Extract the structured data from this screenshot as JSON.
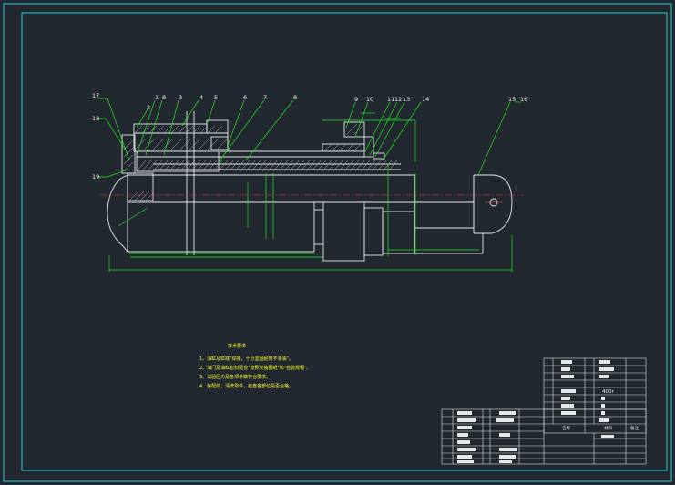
{
  "part_numbers": [
    {
      "id": "17",
      "text": "17"
    },
    {
      "id": "1",
      "text": "1"
    },
    {
      "id": "8a",
      "text": "8"
    },
    {
      "id": "3",
      "text": "3"
    },
    {
      "id": "4",
      "text": "4"
    },
    {
      "id": "5",
      "text": "5"
    },
    {
      "id": "2",
      "text": "2"
    },
    {
      "id": "6",
      "text": "6"
    },
    {
      "id": "7",
      "text": "7"
    },
    {
      "id": "8b",
      "text": "8"
    },
    {
      "id": "9",
      "text": "9"
    },
    {
      "id": "10",
      "text": "10"
    },
    {
      "id": "11",
      "text": "11"
    },
    {
      "id": "12",
      "text": "12"
    },
    {
      "id": "13",
      "text": "13"
    },
    {
      "id": "14",
      "text": "14"
    },
    {
      "id": "15",
      "text": "15"
    },
    {
      "id": "16",
      "text": "16"
    },
    {
      "id": "18",
      "text": "18"
    },
    {
      "id": "19",
      "text": "19"
    }
  ],
  "tech_notes": {
    "title": "技术要求",
    "items": [
      "1、油缸及缸底\"焊接，十分坚固耐用不渗油\"。",
      "2、油门及油缸密封配合\"按照安装图纸\"和\"检验规程\"。",
      "3、试验压力及各项参数符合要求。",
      "4、装配前，清洗零件，检查各部位是否合格。"
    ]
  },
  "title_block": {
    "scale_text": "400r",
    "header_name": "名称",
    "header_material": "材料",
    "header_remark": "备注"
  }
}
